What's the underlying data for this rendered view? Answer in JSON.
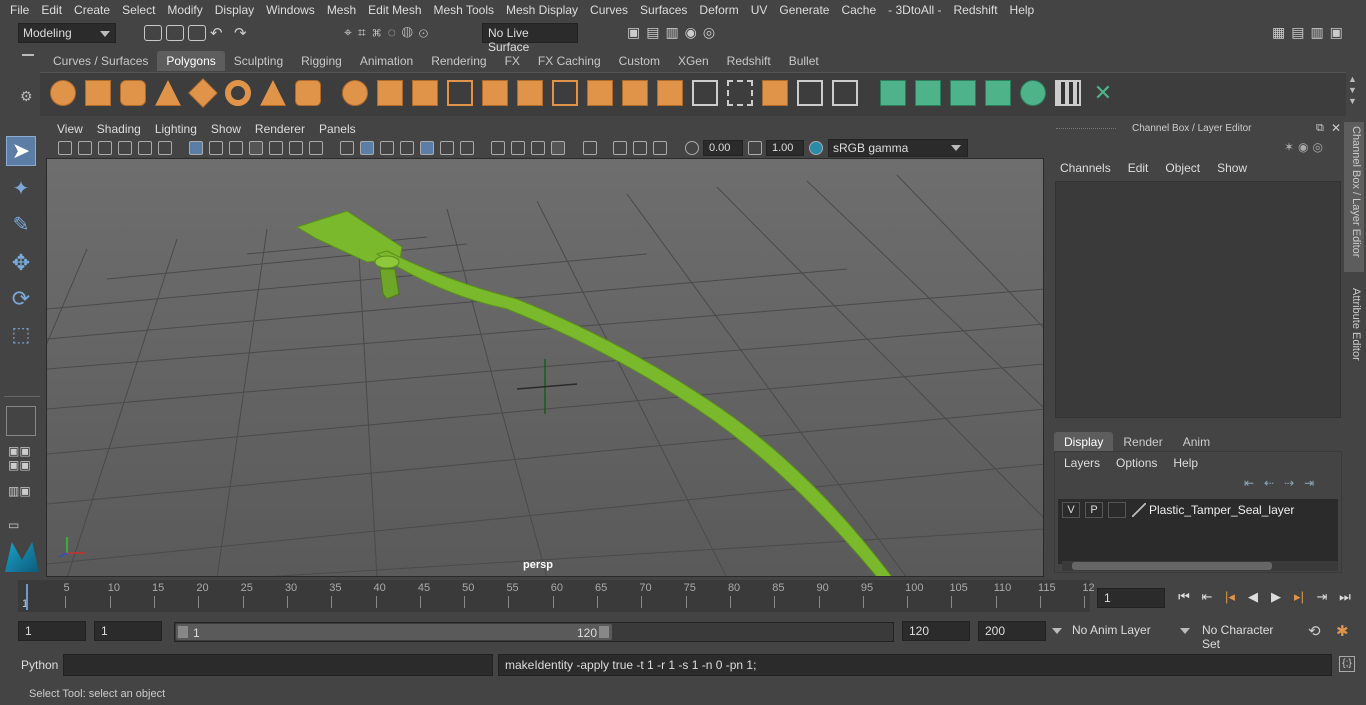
{
  "menubar": [
    "File",
    "Edit",
    "Create",
    "Select",
    "Modify",
    "Display",
    "Windows",
    "Mesh",
    "Edit Mesh",
    "Mesh Tools",
    "Mesh Display",
    "Curves",
    "Surfaces",
    "Deform",
    "UV",
    "Generate",
    "Cache",
    "- 3DtoAll -",
    "Redshift",
    "Help"
  ],
  "status": {
    "mode": "Modeling",
    "live_surface": "No Live Surface"
  },
  "shelf": {
    "tabs": [
      "Curves / Surfaces",
      "Polygons",
      "Sculpting",
      "Rigging",
      "Animation",
      "Rendering",
      "FX",
      "FX Caching",
      "Custom",
      "XGen",
      "Redshift",
      "Bullet"
    ],
    "active_tab": "Polygons"
  },
  "viewport": {
    "menu": [
      "View",
      "Shading",
      "Lighting",
      "Show",
      "Renderer",
      "Panels"
    ],
    "exposure": "0.00",
    "gamma_value": "1.00",
    "color_space": "sRGB gamma",
    "camera": "persp"
  },
  "channel_box": {
    "title": "Channel Box / Layer Editor",
    "menu": [
      "Channels",
      "Edit",
      "Object",
      "Show"
    ]
  },
  "layer_editor": {
    "tabs": [
      "Display",
      "Render",
      "Anim"
    ],
    "active_tab": "Display",
    "menu": [
      "Layers",
      "Options",
      "Help"
    ],
    "layers": [
      {
        "v": "V",
        "p": "P",
        "name": "Plastic_Tamper_Seal_layer"
      }
    ]
  },
  "side_tabs": [
    "Channel Box / Layer Editor",
    "Attribute Editor"
  ],
  "timeline": {
    "ticks": [
      "5",
      "10",
      "15",
      "20",
      "25",
      "30",
      "35",
      "40",
      "45",
      "50",
      "55",
      "60",
      "65",
      "70",
      "75",
      "80",
      "85",
      "90",
      "95",
      "100",
      "105",
      "110",
      "115",
      "12"
    ],
    "start_mark": "1",
    "current_frame": "1"
  },
  "range": {
    "start": "1",
    "start_inner": "1",
    "slider_start": "1",
    "slider_end": "120",
    "end_inner": "120",
    "end": "200",
    "anim_layer": "No Anim Layer",
    "character_set": "No Character Set"
  },
  "command": {
    "language": "Python",
    "output": "makeIdentity -apply true -t 1 -r 1 -s 1 -n 0 -pn 1;"
  },
  "help_line": "Select Tool: select an object",
  "colors": {
    "mesh_green": "#7ab82c",
    "selected_tool": "#5b7da6",
    "shelf_orange": "#e0944a",
    "shelf_teal": "#4fb38a"
  }
}
